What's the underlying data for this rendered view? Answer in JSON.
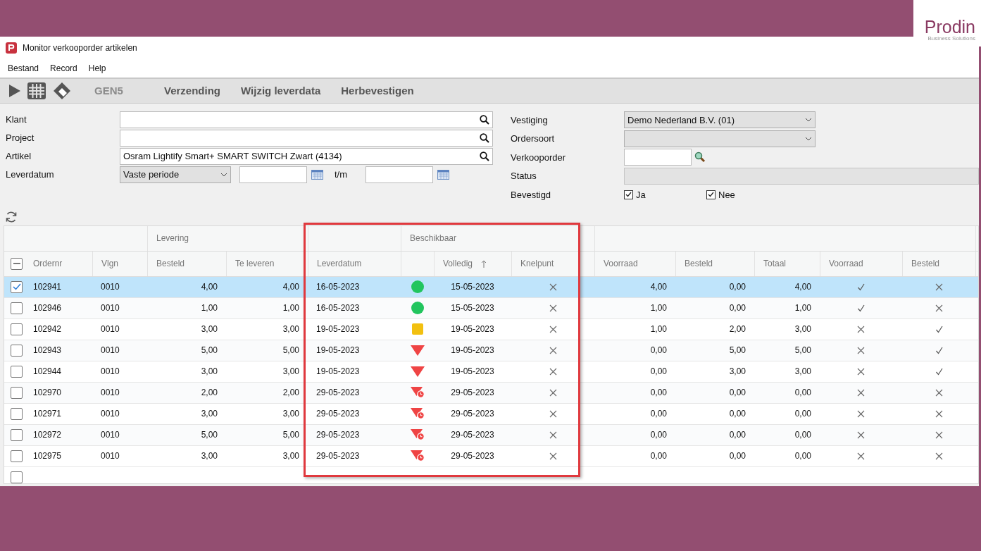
{
  "brand": {
    "name": "Prodin",
    "tagline": "Business Solutions"
  },
  "window": {
    "title": "Monitor verkooporder artikelen"
  },
  "menu": [
    "Bestand",
    "Record",
    "Help"
  ],
  "toolbar": {
    "buttons": [
      {
        "label": "GEN5",
        "disabled": true
      },
      {
        "label": "Verzending",
        "disabled": false
      },
      {
        "label": "Wijzig leverdata",
        "disabled": false
      },
      {
        "label": "Herbevestigen",
        "disabled": false
      }
    ]
  },
  "filters_left": [
    {
      "kind": "lookup",
      "label": "Klant"
    },
    {
      "kind": "lookup",
      "label": "Project"
    },
    {
      "kind": "lookup",
      "label": "Artikel",
      "value": "Osram Lightify Smart+ SMART SWITCH Zwart (4134)"
    },
    {
      "kind": "period",
      "label": "Leverdatum",
      "value": "Vaste periode",
      "separator": "t/m"
    }
  ],
  "filters_right": [
    {
      "kind": "select",
      "label": "Vestiging",
      "value": "Demo Nederland B.V. (01)"
    },
    {
      "kind": "select",
      "label": "Ordersoort"
    },
    {
      "kind": "search",
      "label": "Verkooporder"
    },
    {
      "kind": "readonly",
      "label": "Status"
    },
    {
      "kind": "checks",
      "label": "Bevestigd",
      "options": [
        {
          "label": "Ja",
          "checked": true
        },
        {
          "label": "Nee",
          "checked": true
        }
      ]
    }
  ],
  "table": {
    "groups": [
      "Levering",
      "Beschikbaar"
    ],
    "select_all": {
      "indeterminate": true
    },
    "columns": [
      {
        "label": "Ordernr",
        "sorted": false
      },
      {
        "label": "Vlgn",
        "sorted": false
      },
      {
        "label": "Besteld",
        "sorted": false
      },
      {
        "label": "Te leveren",
        "sorted": false
      },
      {
        "label": "Leverdatum",
        "sorted": false
      },
      {
        "label": "Volledig",
        "sorted": true
      },
      {
        "label": "Knelpunt",
        "sorted": false
      },
      {
        "label": "Voorraad",
        "sorted": false
      },
      {
        "label": "Besteld",
        "sorted": false
      },
      {
        "label": "Totaal",
        "sorted": false
      },
      {
        "label": "Voorraad",
        "sorted": false
      },
      {
        "label": "Besteld",
        "sorted": false
      }
    ],
    "rows": [
      {
        "checked": true,
        "selected": true,
        "ordernr": "102941",
        "vlgn": "0010",
        "besteld": "4,00",
        "te_leveren": "4,00",
        "leverdatum": "16-05-2023",
        "availability": {
          "kind": "available"
        },
        "volledig": "15-05-2023",
        "knelpunt": false,
        "voorraad": "4,00",
        "besteld_2": "0,00",
        "totaal": "4,00",
        "from_stock": true,
        "from_order": false
      },
      {
        "checked": false,
        "selected": false,
        "ordernr": "102946",
        "vlgn": "0010",
        "besteld": "1,00",
        "te_leveren": "1,00",
        "leverdatum": "16-05-2023",
        "availability": {
          "kind": "available"
        },
        "volledig": "15-05-2023",
        "knelpunt": false,
        "voorraad": "1,00",
        "besteld_2": "0,00",
        "totaal": "1,00",
        "from_stock": true,
        "from_order": false
      },
      {
        "checked": false,
        "selected": false,
        "ordernr": "102942",
        "vlgn": "0010",
        "besteld": "3,00",
        "te_leveren": "3,00",
        "leverdatum": "19-05-2023",
        "availability": {
          "kind": "partial"
        },
        "volledig": "19-05-2023",
        "knelpunt": false,
        "voorraad": "1,00",
        "besteld_2": "2,00",
        "totaal": "3,00",
        "from_stock": false,
        "from_order": true
      },
      {
        "checked": false,
        "selected": false,
        "ordernr": "102943",
        "vlgn": "0010",
        "besteld": "5,00",
        "te_leveren": "5,00",
        "leverdatum": "19-05-2023",
        "availability": {
          "kind": "short"
        },
        "volledig": "19-05-2023",
        "knelpunt": false,
        "voorraad": "0,00",
        "besteld_2": "5,00",
        "totaal": "5,00",
        "from_stock": false,
        "from_order": true
      },
      {
        "checked": false,
        "selected": false,
        "ordernr": "102944",
        "vlgn": "0010",
        "besteld": "3,00",
        "te_leveren": "3,00",
        "leverdatum": "19-05-2023",
        "availability": {
          "kind": "short"
        },
        "volledig": "19-05-2023",
        "knelpunt": false,
        "voorraad": "0,00",
        "besteld_2": "3,00",
        "totaal": "3,00",
        "from_stock": false,
        "from_order": true
      },
      {
        "checked": false,
        "selected": false,
        "ordernr": "102970",
        "vlgn": "0010",
        "besteld": "2,00",
        "te_leveren": "2,00",
        "leverdatum": "29-05-2023",
        "availability": {
          "kind": "late"
        },
        "volledig": "29-05-2023",
        "knelpunt": false,
        "voorraad": "0,00",
        "besteld_2": "0,00",
        "totaal": "0,00",
        "from_stock": false,
        "from_order": false
      },
      {
        "checked": false,
        "selected": false,
        "ordernr": "102971",
        "vlgn": "0010",
        "besteld": "3,00",
        "te_leveren": "3,00",
        "leverdatum": "29-05-2023",
        "availability": {
          "kind": "late"
        },
        "volledig": "29-05-2023",
        "knelpunt": false,
        "voorraad": "0,00",
        "besteld_2": "0,00",
        "totaal": "0,00",
        "from_stock": false,
        "from_order": false
      },
      {
        "checked": false,
        "selected": false,
        "ordernr": "102972",
        "vlgn": "0010",
        "besteld": "5,00",
        "te_leveren": "5,00",
        "leverdatum": "29-05-2023",
        "availability": {
          "kind": "late"
        },
        "volledig": "29-05-2023",
        "knelpunt": false,
        "voorraad": "0,00",
        "besteld_2": "0,00",
        "totaal": "0,00",
        "from_stock": false,
        "from_order": false
      },
      {
        "checked": false,
        "selected": false,
        "ordernr": "102975",
        "vlgn": "0010",
        "besteld": "3,00",
        "te_leveren": "3,00",
        "leverdatum": "29-05-2023",
        "availability": {
          "kind": "late"
        },
        "volledig": "29-05-2023",
        "knelpunt": false,
        "voorraad": "0,00",
        "besteld_2": "0,00",
        "totaal": "0,00",
        "from_stock": false,
        "from_order": false
      }
    ],
    "new_row": {
      "checked": false
    }
  }
}
